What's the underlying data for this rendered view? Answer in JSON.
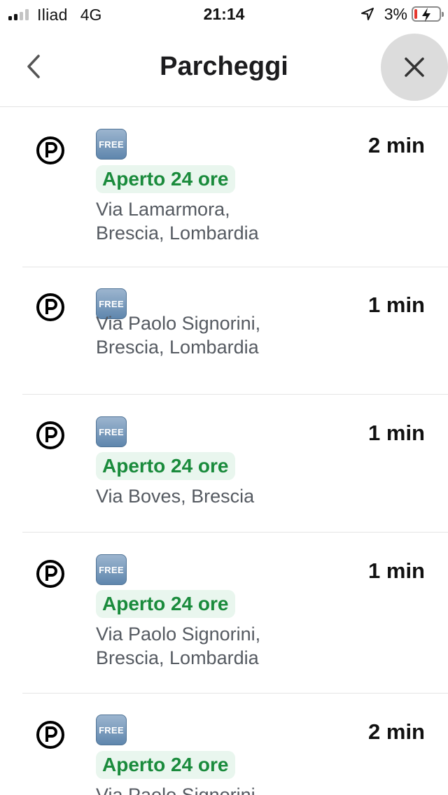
{
  "status_bar": {
    "carrier": "Iliad",
    "network": "4G",
    "time": "21:14",
    "battery_percent": "3%",
    "signal_bars_active": 2,
    "signal_bars_total": 4,
    "battery_level": 0.03,
    "charging": true
  },
  "header": {
    "title": "Parcheggi",
    "back_icon": "chevron-left-icon",
    "close_icon": "close-icon"
  },
  "colors": {
    "open_text": "#1a8b3c",
    "open_bg": "#e9f6ee",
    "address_text": "#555a61",
    "battery_low": "#e5372e",
    "close_button_bg": "#dcdcdc"
  },
  "parking_list": [
    {
      "icon": "parking-icon",
      "badge": "FREE",
      "status": "Aperto 24 ore",
      "address_line1": "Via Lamarmora,",
      "address_line2": "Brescia, Lombardia",
      "duration": "2 min"
    },
    {
      "icon": "parking-icon",
      "badge": "FREE",
      "status": "",
      "address_line1": "Via Paolo Signorini,",
      "address_line2": "Brescia, Lombardia",
      "duration": "1 min"
    },
    {
      "icon": "parking-icon",
      "badge": "FREE",
      "status": "Aperto 24 ore",
      "address_line1": "Via Boves, Brescia",
      "address_line2": "",
      "duration": "1 min"
    },
    {
      "icon": "parking-icon",
      "badge": "FREE",
      "status": "Aperto 24 ore",
      "address_line1": "Via Paolo Signorini,",
      "address_line2": "Brescia, Lombardia",
      "duration": "1 min"
    },
    {
      "icon": "parking-icon",
      "badge": "FREE",
      "status": "Aperto 24 ore",
      "address_line1": "Via Paolo Signorini,",
      "address_line2": "",
      "duration": "2 min"
    }
  ]
}
